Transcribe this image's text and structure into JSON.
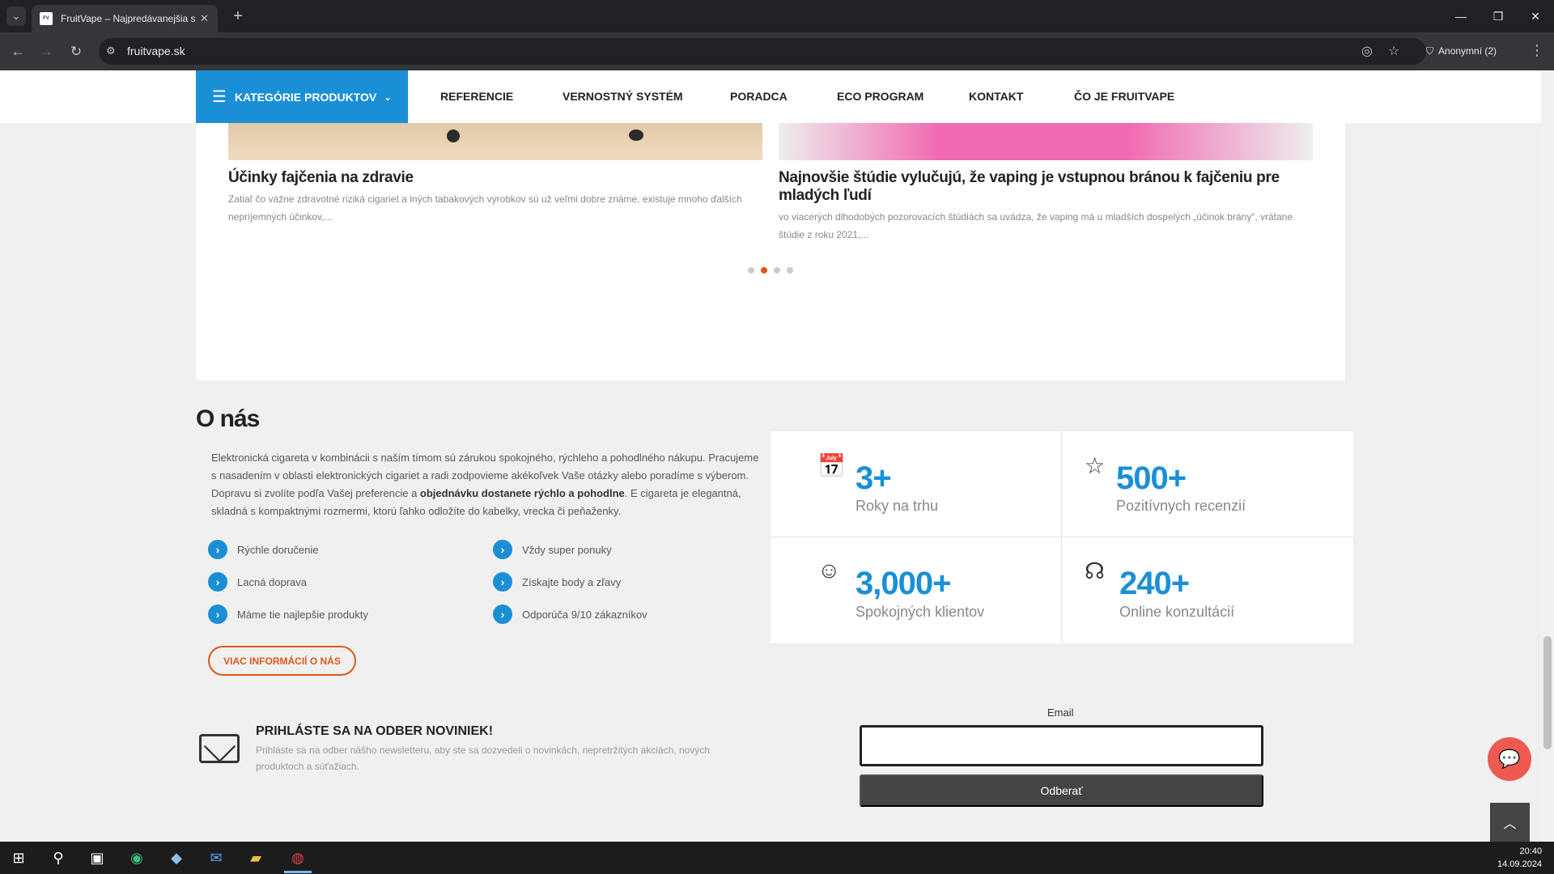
{
  "browser": {
    "tab_title": "FruitVape – Najpredávanejšia sí",
    "url": "fruitvape.sk",
    "profile_label": "Anonymní (2)"
  },
  "nav": {
    "category_button": "KATEGÓRIE PRODUKTOV",
    "items": [
      "REFERENCIE",
      "VERNOSTNÝ SYSTÉM",
      "PORADCA",
      "ECO PROGRAM",
      "KONTAKT",
      "ČO JE FRUITVAPE"
    ]
  },
  "articles": [
    {
      "title": "Účinky fajčenia na zdravie",
      "desc": "Zatiaľ čo vážne zdravotné riziká cigariet a iných tabakových výrobkov sú už veľmi dobre známe, existuje mnoho ďalších nepríjemných účinkov,..."
    },
    {
      "title": "Najnovšie štúdie vylučujú, že vaping je vstupnou bránou k fajčeniu pre mladých ľudí",
      "desc": "vo viacerých dlhodobých pozorovacích štúdiách sa uvádza, že vaping má u mladších dospelých „účinok brány“, vrátane štúdie z roku 2021,..."
    }
  ],
  "carousel": {
    "active_index": 1,
    "count": 4
  },
  "about": {
    "title": "O nás",
    "text_part1": "Elektronická cigareta v kombinácii s naším tímom sú zárukou spokojného, rýchleho a pohodlného nákupu. Pracujeme s nasadením v oblasti elektronických cigariet a radi zodpovieme akékoľvek Vaše otázky alebo poradíme s výberom. Dopravu si zvolíte podľa Vašej preferencie a ",
    "text_bold": "objednávku dostanete rýchlo a pohodlne",
    "text_part2": ". E cigareta je elegantná, skladná s kompaktnými rozmermi, ktorú ľahko odložíte do kabelky, vrecka či peňaženky.",
    "features": [
      "Rýchle doručenie",
      "Vždy super ponuky",
      "Lacná doprava",
      "Získajte body a zľavy",
      "Máme tie najlepšie produkty",
      "Odporúča 9/10 zákazníkov"
    ],
    "more_button": "VIAC INFORMÁCIÍ O NÁS"
  },
  "stats": [
    {
      "number": "3+",
      "label": "Roky na trhu",
      "icon": "calendar-icon"
    },
    {
      "number": "500+",
      "label": "Pozitívnych recenzií",
      "icon": "award-icon"
    },
    {
      "number": "3,000+",
      "label": "Spokojných klientov",
      "icon": "smile-icon"
    },
    {
      "number": "240+",
      "label": "Online konzultácií",
      "icon": "headset-icon"
    }
  ],
  "newsletter": {
    "title": "PRIHLÁSTE SA NA ODBER NOVINIEK!",
    "desc": "Prihláste sa na odber nášho newsletteru, aby ste sa dozvedeli o novinkách, nepretržitých akciách, nových produktoch a súťažiach.",
    "email_label": "Email",
    "email_value": "",
    "submit_label": "Odberať"
  },
  "taskbar": {
    "time": "20:40",
    "date": "14.09.2024"
  },
  "colors": {
    "accent_blue": "#1a8fd6",
    "accent_orange": "#e0571a"
  }
}
